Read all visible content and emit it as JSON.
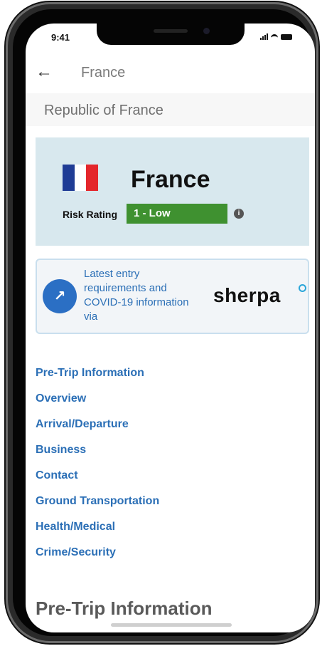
{
  "status_bar": {
    "time": "9:41"
  },
  "header": {
    "back_icon": "arrow-left-icon",
    "title": "France"
  },
  "subheader": {
    "official_name": "Republic of France"
  },
  "country_card": {
    "flag_colors": [
      "#1f3c95",
      "#ffffff",
      "#e4262b"
    ],
    "country_name": "France",
    "risk_label": "Risk Rating",
    "risk_value": "1 - Low",
    "risk_color": "#3f9130",
    "info_icon": "i"
  },
  "sherpa_card": {
    "icon": "external-link-icon",
    "text": "Latest entry requirements and COVID-19 information via",
    "logo_text": "sherpa"
  },
  "nav_links": [
    "Pre-Trip Information",
    "Overview",
    "Arrival/Departure",
    "Business",
    "Contact",
    "Ground Transportation",
    "Health/Medical",
    "Crime/Security"
  ],
  "section_heading": "Pre-Trip Information",
  "colors": {
    "link": "#2b6fb6",
    "card_bg": "#d8e8ee",
    "accent_blue": "#2b6fc4"
  }
}
